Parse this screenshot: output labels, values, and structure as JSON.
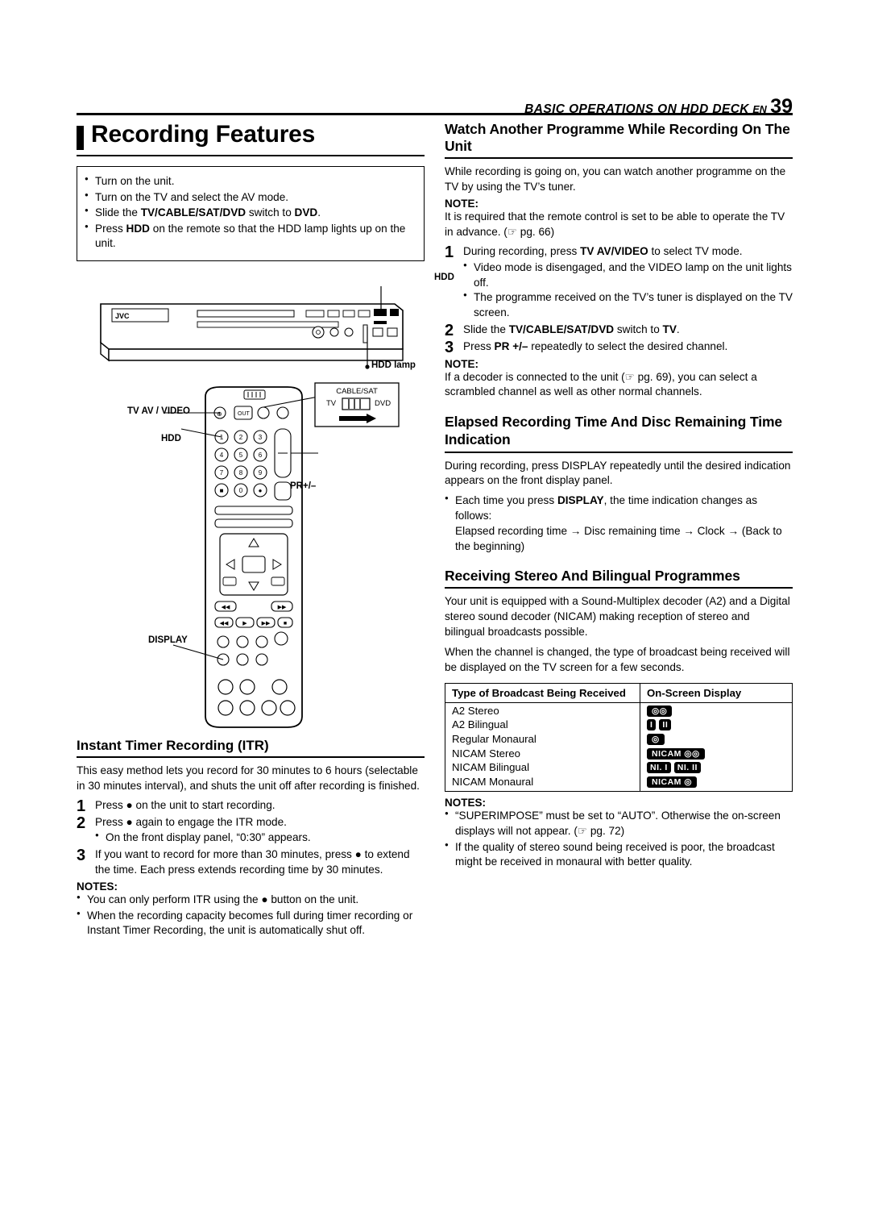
{
  "header": {
    "section": "BASIC OPERATIONS ON HDD DECK",
    "en": "EN",
    "page": "39"
  },
  "left": {
    "title": "Recording Features",
    "prep_bullets": [
      "Turn on the unit.",
      "Turn on the TV and select the AV mode.",
      "Slide the TV/CABLE/SAT/DVD switch to DVD.",
      "Press HDD on the remote so that the HDD lamp lights up on the unit."
    ],
    "figure_labels": {
      "hdd": "HDD",
      "hdd_lamp": "HDD lamp",
      "tv_av_video": "TV AV / VIDEO",
      "hdd_btn": "HDD",
      "pr_plus_minus": "PR+/–",
      "display": "DISPLAY",
      "switch_cable_sat": "CABLE/SAT",
      "switch_tv": "TV",
      "switch_dvd": "DVD",
      "switch_out": "OUT"
    },
    "itr": {
      "title": "Instant Timer Recording (ITR)",
      "intro": "This easy method lets you record for 30 minutes to 6 hours (selectable in 30 minutes interval), and shuts the unit off after recording is finished.",
      "steps": [
        {
          "n": "1",
          "text": "Press ● on the unit to start recording."
        },
        {
          "n": "2",
          "text": "Press ● again to engage the ITR mode.",
          "sub": [
            "On the front display panel, “0:30” appears."
          ]
        },
        {
          "n": "3",
          "text": "If you want to record for more than 30 minutes, press ● to extend the time. Each press extends recording time by 30 minutes."
        }
      ],
      "notes_label": "NOTES:",
      "notes": [
        "You can only perform ITR using the ● button on the unit.",
        "When the recording capacity becomes full during timer recording or Instant Timer Recording, the unit is automatically shut off."
      ]
    }
  },
  "right": {
    "watch": {
      "title": "Watch Another Programme While Recording On The Unit",
      "intro": "While recording is going on, you can watch another programme on the TV by using the TV’s tuner.",
      "note_label": "NOTE:",
      "note": "It is required that the remote control is set to be able to operate the TV in advance. (☞ pg. 66)",
      "steps": [
        {
          "n": "1",
          "text": "During recording, press TV AV/VIDEO to select TV mode.",
          "sub": [
            "Video mode is disengaged, and the VIDEO lamp on the unit lights off.",
            "The programme received on the TV’s tuner is displayed on the TV screen."
          ]
        },
        {
          "n": "2",
          "text": "Slide the TV/CABLE/SAT/DVD switch to TV."
        },
        {
          "n": "3",
          "text": "Press PR +/– repeatedly to select the desired channel."
        }
      ],
      "note2_label": "NOTE:",
      "note2": "If a decoder is connected to the unit (☞ pg. 69), you can select a scrambled channel as well as other normal channels."
    },
    "elapsed": {
      "title": "Elapsed Recording Time And Disc Remaining Time Indication",
      "intro": "During recording, press DISPLAY repeatedly until the desired indication appears on the front display panel.",
      "bullet": "Each time you press DISPLAY, the time indication changes as follows:",
      "sequence": "Elapsed recording time → Disc remaining time → Clock → (Back to the beginning)"
    },
    "stereo": {
      "title": "Receiving Stereo And Bilingual Programmes",
      "para1": "Your unit is equipped with a Sound-Multiplex decoder (A2) and a Digital stereo sound decoder (NICAM) making reception of stereo and bilingual broadcasts possible.",
      "para2": "When the channel is changed, the type of broadcast being received will be displayed on the TV screen for a few seconds.",
      "table": {
        "headers": [
          "Type of Broadcast Being Received",
          "On-Screen Display"
        ],
        "rows": [
          {
            "type": "A2 Stereo",
            "display": [
              "⟨⟩"
            ]
          },
          {
            "type": "A2 Bilingual",
            "display": [
              "I",
              "II"
            ]
          },
          {
            "type": "Regular Monaural",
            "display": [
              "○"
            ]
          },
          {
            "type": "NICAM Stereo",
            "display": [
              "NICAM ⟨⟩"
            ]
          },
          {
            "type": "NICAM Bilingual",
            "display": [
              "NI. I",
              "NI. II"
            ]
          },
          {
            "type": "NICAM Monaural",
            "display": [
              "NICAM ○"
            ]
          }
        ]
      },
      "notes_label": "NOTES:",
      "notes": [
        "“SUPERIMPOSE” must be set to “AUTO”. Otherwise the on-screen displays will not appear. (☞ pg. 72)",
        "If the quality of stereo sound being received is poor, the broadcast might be received in monaural with better quality."
      ]
    }
  }
}
